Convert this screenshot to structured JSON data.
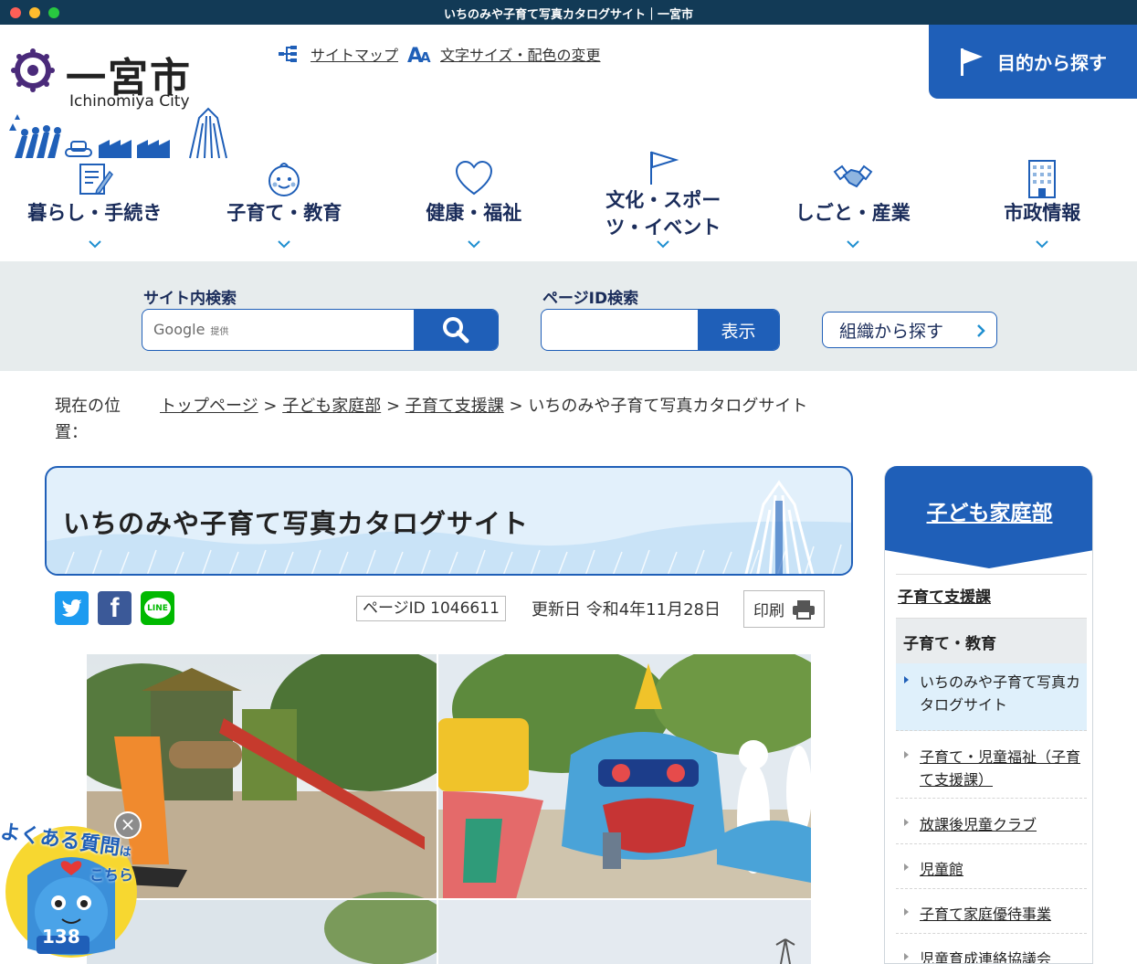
{
  "window": {
    "title": "いちのみや子育て写真カタログサイト｜一宮市"
  },
  "logo": {
    "name_jp": "一宮市",
    "name_en": "Ichinomiya City"
  },
  "utility": {
    "sitemap": "サイトマップ",
    "fontsize": "文字サイズ・配色の変更"
  },
  "purpose_button": "目的から探す",
  "nav": [
    {
      "label": "暮らし・手続き",
      "icon": "form-icon"
    },
    {
      "label": "子育て・教育",
      "icon": "baby-face-icon"
    },
    {
      "label": "健康・福祉",
      "icon": "heart-icon"
    },
    {
      "label": "文化・スポーツ・イベント",
      "icon": "flag-icon"
    },
    {
      "label": "しごと・産業",
      "icon": "handshake-icon"
    },
    {
      "label": "市政情報",
      "icon": "building-icon"
    }
  ],
  "search": {
    "site_label": "サイト内検索",
    "site_placeholder_brand": "Google",
    "site_placeholder_suffix": "提供",
    "pageid_label": "ページID検索",
    "pageid_button": "表示",
    "org_button": "組織から探す"
  },
  "breadcrumb": {
    "head": "現在の位置：",
    "items": [
      "トップページ",
      "子ども家庭部",
      "子育て支援課"
    ],
    "current": "いちのみや子育て写真カタログサイト",
    "sep": ">"
  },
  "page": {
    "title": "いちのみや子育て写真カタログサイト",
    "page_id": "ページID 1046611",
    "updated": "更新日 令和4年11月28日",
    "print": "印刷"
  },
  "share": {
    "twitter_glyph": "t",
    "facebook_glyph": "f",
    "line_glyph": "LINE"
  },
  "sidebar": {
    "title": "子ども家庭部",
    "link1": "子育て支援課",
    "category": "子育て・教育",
    "items": [
      {
        "label": "いちのみや子育て写真カタログサイト",
        "active": true
      },
      {
        "label": "子育て・児童福祉（子育て支援課）",
        "active": false
      },
      {
        "label": "放課後児童クラブ",
        "active": false
      },
      {
        "label": "児童館",
        "active": false
      },
      {
        "label": "子育て家庭優待事業",
        "active": false
      },
      {
        "label": "児童育成連絡協議会",
        "active": false
      }
    ]
  },
  "faq": {
    "line1": "よくある質問",
    "line2": "は",
    "line3": "こちら",
    "number": "138",
    "close": "×"
  },
  "colors": {
    "brand": "#1f5fb8",
    "navy": "#1a2c5a",
    "titlebar": "#123a56",
    "band": "#e7eced"
  }
}
